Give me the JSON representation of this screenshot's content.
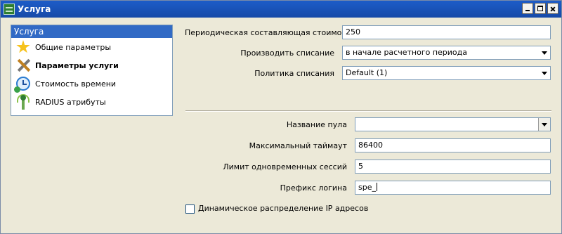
{
  "window": {
    "title": "Услуга"
  },
  "sidebar": {
    "header": "Услуга",
    "items": [
      {
        "label": "Общие параметры",
        "icon": "star-icon"
      },
      {
        "label": "Параметры услуги",
        "icon": "tools-icon",
        "active": true
      },
      {
        "label": "Стоимость времени",
        "icon": "clock-icon"
      },
      {
        "label": "RADIUS атрибуты",
        "icon": "antenna-icon"
      }
    ]
  },
  "form": {
    "periodic_cost": {
      "label": "Периодическая составляющая стоимости",
      "value": "250"
    },
    "charge_mode": {
      "label": "Производить списание",
      "value": "в начале расчетного периода"
    },
    "charge_policy": {
      "label": "Политика списания",
      "value": "Default (1)"
    },
    "pool_name": {
      "label": "Название пула",
      "value": ""
    },
    "max_timeout": {
      "label": "Максимальный таймаут",
      "value": "86400"
    },
    "session_limit": {
      "label": "Лимит одновременных сессий",
      "value": "5"
    },
    "login_prefix": {
      "label": "Префикс логина",
      "value": "spe_"
    },
    "dynamic_ip": {
      "label": "Динамическое распределение IP адресов",
      "checked": false
    }
  },
  "colors": {
    "titlebar": "#164aa8",
    "selection": "#316ac5",
    "window_bg": "#ece9d8"
  }
}
